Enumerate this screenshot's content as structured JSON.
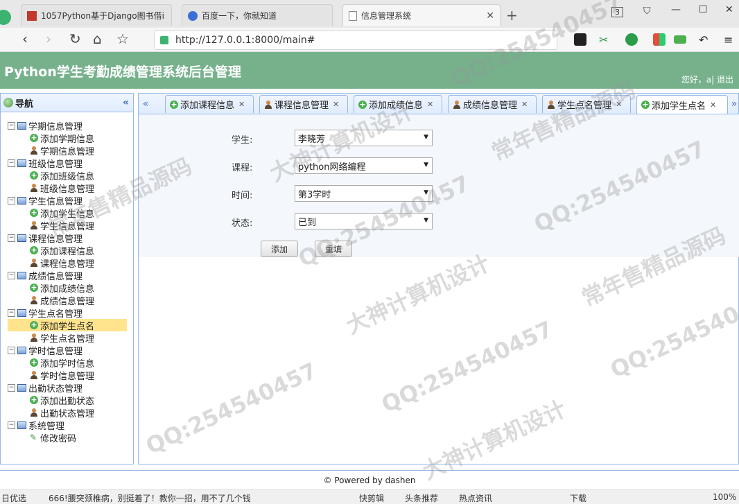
{
  "browser": {
    "tabs": [
      {
        "label": "1057Python基于Django图书借i"
      },
      {
        "label": "百度一下，你就知道"
      },
      {
        "label": "信息管理系统"
      }
    ],
    "tab_count": "3",
    "url": "http://127.0.0.1:8000/main#"
  },
  "header": {
    "title": "Python学生考勤成绩管理系统后台管理",
    "greeting": "您好，a| 退出"
  },
  "nav": {
    "title": "导航",
    "groups": [
      {
        "label": "学期信息管理",
        "children": [
          "添加学期信息",
          "学期信息管理"
        ]
      },
      {
        "label": "班级信息管理",
        "children": [
          "添加班级信息",
          "班级信息管理"
        ]
      },
      {
        "label": "学生信息管理",
        "children": [
          "添加学生信息",
          "学生信息管理"
        ]
      },
      {
        "label": "课程信息管理",
        "children": [
          "添加课程信息",
          "课程信息管理"
        ]
      },
      {
        "label": "成绩信息管理",
        "children": [
          "添加成绩信息",
          "成绩信息管理"
        ]
      },
      {
        "label": "学生点名管理",
        "children": [
          "添加学生点名",
          "学生点名管理"
        ]
      },
      {
        "label": "学时信息管理",
        "children": [
          "添加学时信息",
          "学时信息管理"
        ]
      },
      {
        "label": "出勤状态管理",
        "children": [
          "添加出勤状态",
          "出勤状态管理"
        ]
      },
      {
        "label": "系统管理",
        "children": [
          "修改密码"
        ]
      }
    ]
  },
  "page_tabs": [
    {
      "label": "添加课程信息"
    },
    {
      "label": "课程信息管理"
    },
    {
      "label": "添加成绩信息"
    },
    {
      "label": "成绩信息管理"
    },
    {
      "label": "学生点名管理"
    },
    {
      "label": "添加学生点名"
    }
  ],
  "form": {
    "student_label": "学生:",
    "student_value": "李晓芳",
    "course_label": "课程:",
    "course_value": "python网络编程",
    "time_label": "时间:",
    "time_value": "第3学时",
    "status_label": "状态:",
    "status_value": "已到",
    "add_button": "添加",
    "reset_button": "重填"
  },
  "footer": {
    "text": "© Powered by dashen"
  },
  "statusbar": {
    "items": [
      "日优选",
      "666!腰突颈椎病，别挺着了！教你一招，用不了几个钱",
      "快剪辑",
      "头条推荐",
      "热点资讯",
      "下载",
      "100%"
    ]
  },
  "watermarks": [
    "QQ:254540457",
    "大神计算机设计",
    "常年售精品源码"
  ]
}
